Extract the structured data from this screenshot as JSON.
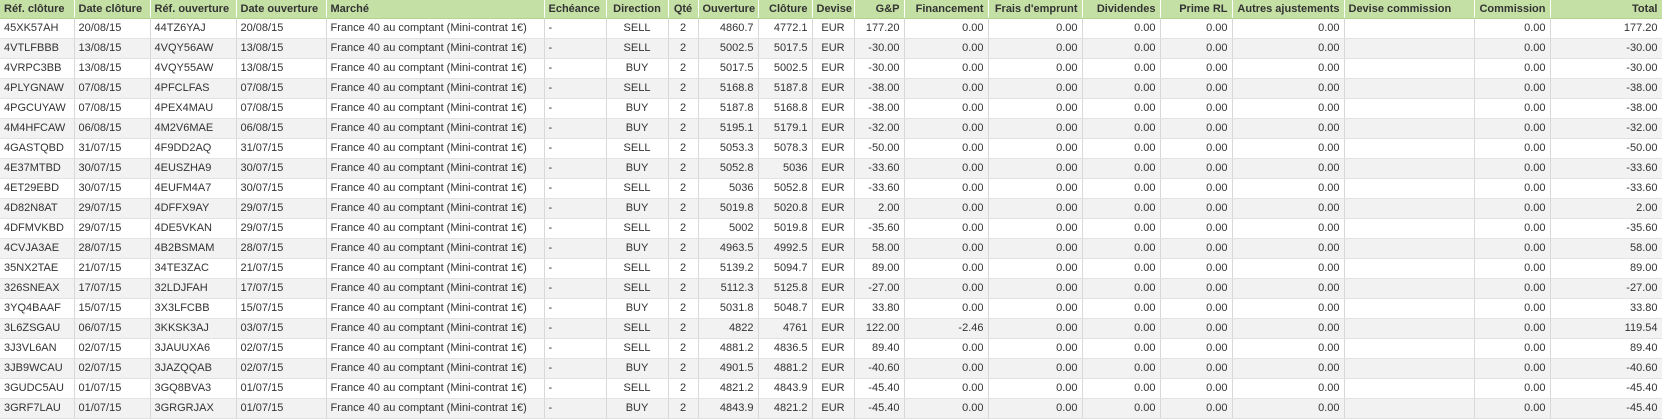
{
  "columns": [
    {
      "label": "Réf. clôture",
      "align": "left"
    },
    {
      "label": "Date clôture",
      "align": "left"
    },
    {
      "label": "Réf. ouverture",
      "align": "left"
    },
    {
      "label": "Date ouverture",
      "align": "left"
    },
    {
      "label": "Marché",
      "align": "left"
    },
    {
      "label": "Echéance",
      "align": "left"
    },
    {
      "label": "Direction",
      "align": "ctr"
    },
    {
      "label": "Qté",
      "align": "ctr"
    },
    {
      "label": "Ouverture",
      "align": "num"
    },
    {
      "label": "Clôture",
      "align": "num"
    },
    {
      "label": "Devise",
      "align": "ctr"
    },
    {
      "label": "G&P",
      "align": "num"
    },
    {
      "label": "Financement",
      "align": "num"
    },
    {
      "label": "Frais d'emprunt",
      "align": "num"
    },
    {
      "label": "Dividendes",
      "align": "num"
    },
    {
      "label": "Prime RL",
      "align": "num"
    },
    {
      "label": "Autres ajustements",
      "align": "num"
    },
    {
      "label": "Devise commission",
      "align": "left"
    },
    {
      "label": "Commission",
      "align": "num"
    },
    {
      "label": "Total",
      "align": "num"
    }
  ],
  "rows": [
    [
      "45XK57AH",
      "20/08/15",
      "44TZ6YAJ",
      "20/08/15",
      "France 40 au comptant (Mini-contrat 1€)",
      "-",
      "SELL",
      "2",
      "4860.7",
      "4772.1",
      "EUR",
      "177.20",
      "0.00",
      "0.00",
      "0.00",
      "0.00",
      "0.00",
      "",
      "0.00",
      "177.20"
    ],
    [
      "4VTLFBBB",
      "13/08/15",
      "4VQY56AW",
      "13/08/15",
      "France 40 au comptant (Mini-contrat 1€)",
      "-",
      "SELL",
      "2",
      "5002.5",
      "5017.5",
      "EUR",
      "-30.00",
      "0.00",
      "0.00",
      "0.00",
      "0.00",
      "0.00",
      "",
      "0.00",
      "-30.00"
    ],
    [
      "4VRPC3BB",
      "13/08/15",
      "4VQY55AW",
      "13/08/15",
      "France 40 au comptant (Mini-contrat 1€)",
      "-",
      "BUY",
      "2",
      "5017.5",
      "5002.5",
      "EUR",
      "-30.00",
      "0.00",
      "0.00",
      "0.00",
      "0.00",
      "0.00",
      "",
      "0.00",
      "-30.00"
    ],
    [
      "4PLYGNAW",
      "07/08/15",
      "4PFCLFAS",
      "07/08/15",
      "France 40 au comptant (Mini-contrat 1€)",
      "-",
      "SELL",
      "2",
      "5168.8",
      "5187.8",
      "EUR",
      "-38.00",
      "0.00",
      "0.00",
      "0.00",
      "0.00",
      "0.00",
      "",
      "0.00",
      "-38.00"
    ],
    [
      "4PGCUYAW",
      "07/08/15",
      "4PEX4MAU",
      "07/08/15",
      "France 40 au comptant (Mini-contrat 1€)",
      "-",
      "BUY",
      "2",
      "5187.8",
      "5168.8",
      "EUR",
      "-38.00",
      "0.00",
      "0.00",
      "0.00",
      "0.00",
      "0.00",
      "",
      "0.00",
      "-38.00"
    ],
    [
      "4M4HFCAW",
      "06/08/15",
      "4M2V6MAE",
      "06/08/15",
      "France 40 au comptant (Mini-contrat 1€)",
      "-",
      "BUY",
      "2",
      "5195.1",
      "5179.1",
      "EUR",
      "-32.00",
      "0.00",
      "0.00",
      "0.00",
      "0.00",
      "0.00",
      "",
      "0.00",
      "-32.00"
    ],
    [
      "4GASTQBD",
      "31/07/15",
      "4F9DD2AQ",
      "31/07/15",
      "France 40 au comptant (Mini-contrat 1€)",
      "-",
      "SELL",
      "2",
      "5053.3",
      "5078.3",
      "EUR",
      "-50.00",
      "0.00",
      "0.00",
      "0.00",
      "0.00",
      "0.00",
      "",
      "0.00",
      "-50.00"
    ],
    [
      "4E37MTBD",
      "30/07/15",
      "4EUSZHA9",
      "30/07/15",
      "France 40 au comptant (Mini-contrat 1€)",
      "-",
      "BUY",
      "2",
      "5052.8",
      "5036",
      "EUR",
      "-33.60",
      "0.00",
      "0.00",
      "0.00",
      "0.00",
      "0.00",
      "",
      "0.00",
      "-33.60"
    ],
    [
      "4ET29EBD",
      "30/07/15",
      "4EUFM4A7",
      "30/07/15",
      "France 40 au comptant (Mini-contrat 1€)",
      "-",
      "SELL",
      "2",
      "5036",
      "5052.8",
      "EUR",
      "-33.60",
      "0.00",
      "0.00",
      "0.00",
      "0.00",
      "0.00",
      "",
      "0.00",
      "-33.60"
    ],
    [
      "4D82N8AT",
      "29/07/15",
      "4DFFX9AY",
      "29/07/15",
      "France 40 au comptant (Mini-contrat 1€)",
      "-",
      "BUY",
      "2",
      "5019.8",
      "5020.8",
      "EUR",
      "2.00",
      "0.00",
      "0.00",
      "0.00",
      "0.00",
      "0.00",
      "",
      "0.00",
      "2.00"
    ],
    [
      "4DFMVKBD",
      "29/07/15",
      "4DE5VKAN",
      "29/07/15",
      "France 40 au comptant (Mini-contrat 1€)",
      "-",
      "SELL",
      "2",
      "5002",
      "5019.8",
      "EUR",
      "-35.60",
      "0.00",
      "0.00",
      "0.00",
      "0.00",
      "0.00",
      "",
      "0.00",
      "-35.60"
    ],
    [
      "4CVJA3AE",
      "28/07/15",
      "4B2BSMAM",
      "28/07/15",
      "France 40 au comptant (Mini-contrat 1€)",
      "-",
      "BUY",
      "2",
      "4963.5",
      "4992.5",
      "EUR",
      "58.00",
      "0.00",
      "0.00",
      "0.00",
      "0.00",
      "0.00",
      "",
      "0.00",
      "58.00"
    ],
    [
      "35NX2TAE",
      "21/07/15",
      "34TE3ZAC",
      "21/07/15",
      "France 40 au comptant (Mini-contrat 1€)",
      "-",
      "SELL",
      "2",
      "5139.2",
      "5094.7",
      "EUR",
      "89.00",
      "0.00",
      "0.00",
      "0.00",
      "0.00",
      "0.00",
      "",
      "0.00",
      "89.00"
    ],
    [
      "326SNEAX",
      "17/07/15",
      "32LDJFAH",
      "17/07/15",
      "France 40 au comptant (Mini-contrat 1€)",
      "-",
      "SELL",
      "2",
      "5112.3",
      "5125.8",
      "EUR",
      "-27.00",
      "0.00",
      "0.00",
      "0.00",
      "0.00",
      "0.00",
      "",
      "0.00",
      "-27.00"
    ],
    [
      "3YQ4BAAF",
      "15/07/15",
      "3X3LFCBB",
      "15/07/15",
      "France 40 au comptant (Mini-contrat 1€)",
      "-",
      "BUY",
      "2",
      "5031.8",
      "5048.7",
      "EUR",
      "33.80",
      "0.00",
      "0.00",
      "0.00",
      "0.00",
      "0.00",
      "",
      "0.00",
      "33.80"
    ],
    [
      "3L6ZSGAU",
      "06/07/15",
      "3KKSK3AJ",
      "03/07/15",
      "France 40 au comptant (Mini-contrat 1€)",
      "-",
      "SELL",
      "2",
      "4822",
      "4761",
      "EUR",
      "122.00",
      "-2.46",
      "0.00",
      "0.00",
      "0.00",
      "0.00",
      "",
      "0.00",
      "119.54"
    ],
    [
      "3J3VL6AN",
      "02/07/15",
      "3JAUUXA6",
      "02/07/15",
      "France 40 au comptant (Mini-contrat 1€)",
      "-",
      "SELL",
      "2",
      "4881.2",
      "4836.5",
      "EUR",
      "89.40",
      "0.00",
      "0.00",
      "0.00",
      "0.00",
      "0.00",
      "",
      "0.00",
      "89.40"
    ],
    [
      "3JB9WCAU",
      "02/07/15",
      "3JAZQQAB",
      "02/07/15",
      "France 40 au comptant (Mini-contrat 1€)",
      "-",
      "BUY",
      "2",
      "4901.5",
      "4881.2",
      "EUR",
      "-40.60",
      "0.00",
      "0.00",
      "0.00",
      "0.00",
      "0.00",
      "",
      "0.00",
      "-40.60"
    ],
    [
      "3GUDC5AU",
      "01/07/15",
      "3GQ8BVA3",
      "01/07/15",
      "France 40 au comptant (Mini-contrat 1€)",
      "-",
      "SELL",
      "2",
      "4821.2",
      "4843.9",
      "EUR",
      "-45.40",
      "0.00",
      "0.00",
      "0.00",
      "0.00",
      "0.00",
      "",
      "0.00",
      "-45.40"
    ],
    [
      "3GRF7LAU",
      "01/07/15",
      "3GRGRJAX",
      "01/07/15",
      "France 40 au comptant (Mini-contrat 1€)",
      "-",
      "BUY",
      "2",
      "4843.9",
      "4821.2",
      "EUR",
      "-45.40",
      "0.00",
      "0.00",
      "0.00",
      "0.00",
      "0.00",
      "",
      "0.00",
      "-45.40"
    ]
  ]
}
